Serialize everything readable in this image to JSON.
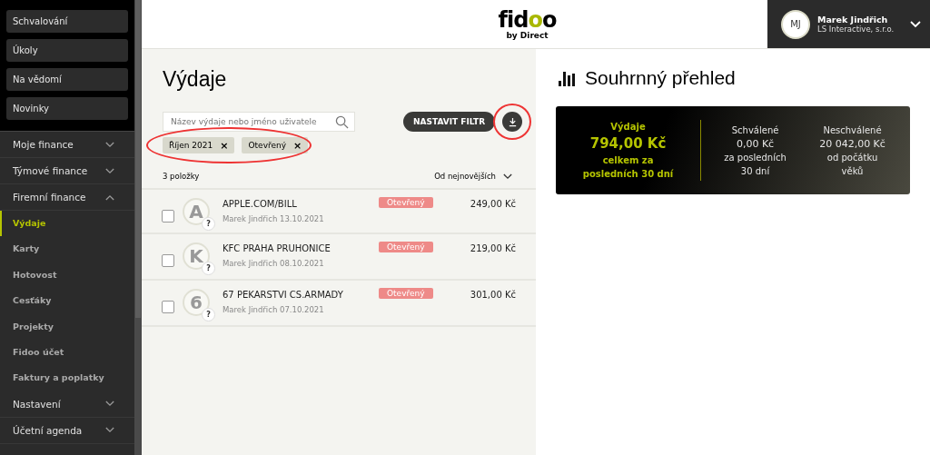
{
  "sidebar": {
    "quick_links": [
      "Schvalování",
      "Úkoly",
      "Na vědomí",
      "Novinky"
    ],
    "sections": [
      {
        "label": "Moje finance",
        "expanded": false
      },
      {
        "label": "Týmové finance",
        "expanded": false
      },
      {
        "label": "Firemní finance",
        "expanded": true,
        "items": [
          {
            "label": "Výdaje",
            "selected": true
          },
          {
            "label": "Karty",
            "selected": false
          },
          {
            "label": "Hotovost",
            "selected": false
          },
          {
            "label": "Cesťáky",
            "selected": false
          },
          {
            "label": "Projekty",
            "selected": false
          },
          {
            "label": "Fidoo účet",
            "selected": false
          },
          {
            "label": "Faktury a poplatky",
            "selected": false
          }
        ]
      },
      {
        "label": "Nastavení",
        "expanded": false
      },
      {
        "label": "Účetní agenda",
        "expanded": false
      }
    ]
  },
  "header": {
    "logo": {
      "segments": [
        {
          "text": "fid"
        },
        {
          "text": "o",
          "color": "#a9b800"
        },
        {
          "text": "o"
        }
      ],
      "subtitle": "by Direct"
    },
    "user": {
      "initials": "MJ",
      "name": "Marek Jindřich",
      "company": "LS Interactive, s.r.o."
    }
  },
  "expenses": {
    "title": "Výdaje",
    "search": {
      "placeholder": "Název výdaje nebo jméno uživatele"
    },
    "filter_button": "NASTAVIT FILTR",
    "download_highlighted": true,
    "filters_highlighted": true,
    "filters": [
      {
        "label": "Říjen 2021",
        "remove": "×"
      },
      {
        "label": "Otevřený",
        "remove": "×"
      }
    ],
    "count": "3 položky",
    "sort": "Od nejnovějších",
    "rows": [
      {
        "checked": false,
        "initial": "A",
        "badge": "?",
        "name": "APPLE.COM/BILL",
        "meta": "Marek Jindřich 13.10.2021",
        "status": "Otevřený",
        "amount": "249,00 Kč"
      },
      {
        "checked": false,
        "initial": "K",
        "badge": "?",
        "name": "KFC PRAHA PRUHONICE",
        "meta": "Marek Jindřich 08.10.2021",
        "status": "Otevřený",
        "amount": "219,00 Kč"
      },
      {
        "checked": false,
        "initial": "6",
        "badge": "?",
        "name": "67 PEKARSTVI CS.ARMADY",
        "meta": "Marek Jindřich 07.10.2021",
        "status": "Otevřený",
        "amount": "301,00 Kč"
      }
    ]
  },
  "summary": {
    "title": "Souhrnný přehled",
    "stats": [
      {
        "kind": "main",
        "label": "Výdaje",
        "value": "794,00 Kč",
        "note": "celkem za posledních 30 dní"
      },
      {
        "kind": "plain",
        "label": "Schválené",
        "value": "0,00 Kč",
        "note": "za posledních 30 dní"
      },
      {
        "kind": "plain",
        "label": "Neschválené",
        "value": "20 042,00 Kč",
        "note": "od počátku věků"
      }
    ]
  }
}
